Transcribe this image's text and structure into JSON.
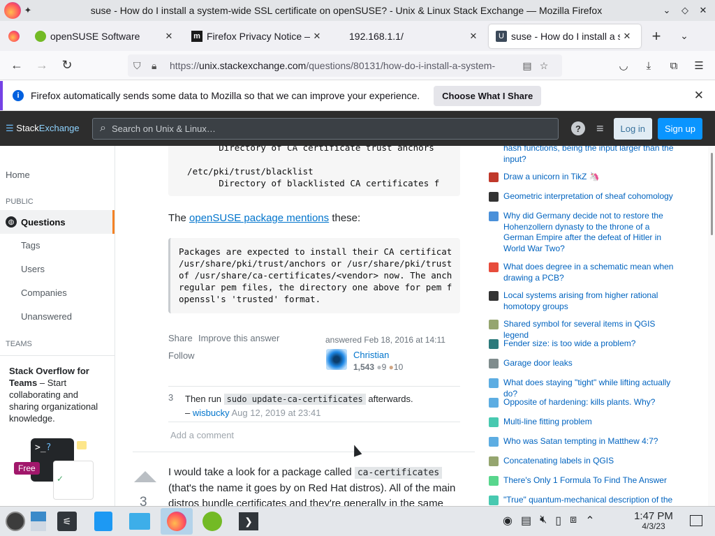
{
  "window": {
    "title": "suse - How do I install a system-wide SSL certificate on openSUSE? - Unix & Linux Stack Exchange — Mozilla Firefox"
  },
  "tabs": [
    {
      "label": "openSUSE Software",
      "icon": "opensuse-icon"
    },
    {
      "label": "Firefox Privacy Notice — M",
      "icon": "mozilla-icon"
    },
    {
      "label": "192.168.1.1/",
      "icon": ""
    },
    {
      "label": "suse - How do I install a sy",
      "icon": "unix-se-icon",
      "active": true
    }
  ],
  "url": {
    "prefix": "https://",
    "host": "unix.stackexchange.com",
    "path": "/questions/80131/how-do-i-install-a-system-"
  },
  "notification": {
    "message": "Firefox automatically sends some data to Mozilla so that we can improve your experience.",
    "button": "Choose What I Share"
  },
  "se_header": {
    "logo_a": "Stack",
    "logo_b": "Exchange",
    "search_placeholder": "Search on Unix & Linux…",
    "login": "Log in",
    "signup": "Sign up"
  },
  "left_nav": {
    "home": "Home",
    "public": "PUBLIC",
    "questions": "Questions",
    "tags": "Tags",
    "users": "Users",
    "companies": "Companies",
    "unanswered": "Unanswered",
    "teams": "TEAMS",
    "teams_title": "Stack Overflow for Teams",
    "teams_rest": " – Start collaborating and sharing organizational knowledge.",
    "free_badge": "Free"
  },
  "answer1": {
    "code_top": "        Directory of CA certificate trust anchors\n\n  /etc/pki/trust/blacklist\n        Directory of blacklisted CA certificates f",
    "para_pre": "The ",
    "para_link": "openSUSE package mentions",
    "para_post": " these:",
    "quote": "Packages are expected to install their CA certificat\n/usr/share/pki/trust/anchors or /usr/share/pki/trust\nof /usr/share/ca-certificates/<vendor> now. The anch\nregular pem files, the directory one above for pem f\nopenssl's 'trusted' format.",
    "share": "Share",
    "improve": "Improve this answer",
    "follow": "Follow",
    "answered": "answered Feb 18, 2016 at 14:11",
    "user": "Christian",
    "rep": "1,543",
    "silver": "9",
    "bronze": "10"
  },
  "comment": {
    "score": "3",
    "pre": "Then run ",
    "code": "sudo update-ca-certificates",
    "post": " afterwards.",
    "dash": "– ",
    "author": "wisbucky",
    "date": "Aug 12, 2019 at 23:41",
    "add": "Add a comment"
  },
  "answer2": {
    "votes": "3",
    "l1_pre": "I would take a look for a package called ",
    "l1_code": "ca-certificates",
    "l2": "(that's the name it goes by on Red Hat distros). All of the main",
    "l3": "distros bundle certificates and they're generally in the same"
  },
  "hot_questions": [
    {
      "text": "hash functions, being the input larger than the input?",
      "color": "#ffffff"
    },
    {
      "text": "Draw a unicorn in TikZ 🦄",
      "color": "#c0392b"
    },
    {
      "text": "Geometric interpretation of sheaf cohomology",
      "color": "#333333"
    },
    {
      "text": "Why did Germany decide not to restore the Hohenzollern dynasty to the throne of a German Empire after the defeat of Hitler in World War Two?",
      "color": "#4a90d9"
    },
    {
      "text": "What does degree in a schematic mean when drawing a PCB?",
      "color": "#e74c3c"
    },
    {
      "text": "Local systems arising from higher rational homotopy groups",
      "color": "#333333"
    },
    {
      "text": "Shared symbol for several items in QGIS legend",
      "color": "#95a56f"
    },
    {
      "text": "Fender size: is too wide a problem?",
      "color": "#2c7a7b"
    },
    {
      "text": "Garage door leaks",
      "color": "#7f8c8d"
    },
    {
      "text": "What does staying \"tight\" while lifting actually do?",
      "color": "#5dade2"
    },
    {
      "text": "Opposite of hardening: kills plants. Why?",
      "color": "#5dade2"
    },
    {
      "text": "Multi-line fitting problem",
      "color": "#48c9b0"
    },
    {
      "text": "Who was Satan tempting in Matthew 4:7?",
      "color": "#5dade2"
    },
    {
      "text": "Concatenating labels in QGIS",
      "color": "#95a56f"
    },
    {
      "text": "There's Only 1 Formula To Find The Answer",
      "color": "#58d68d"
    },
    {
      "text": "\"True\" quantum-mechanical description of the",
      "color": "#48c9b0"
    }
  ],
  "taskbar": {
    "time": "1:47 PM",
    "date": "4/3/23"
  }
}
